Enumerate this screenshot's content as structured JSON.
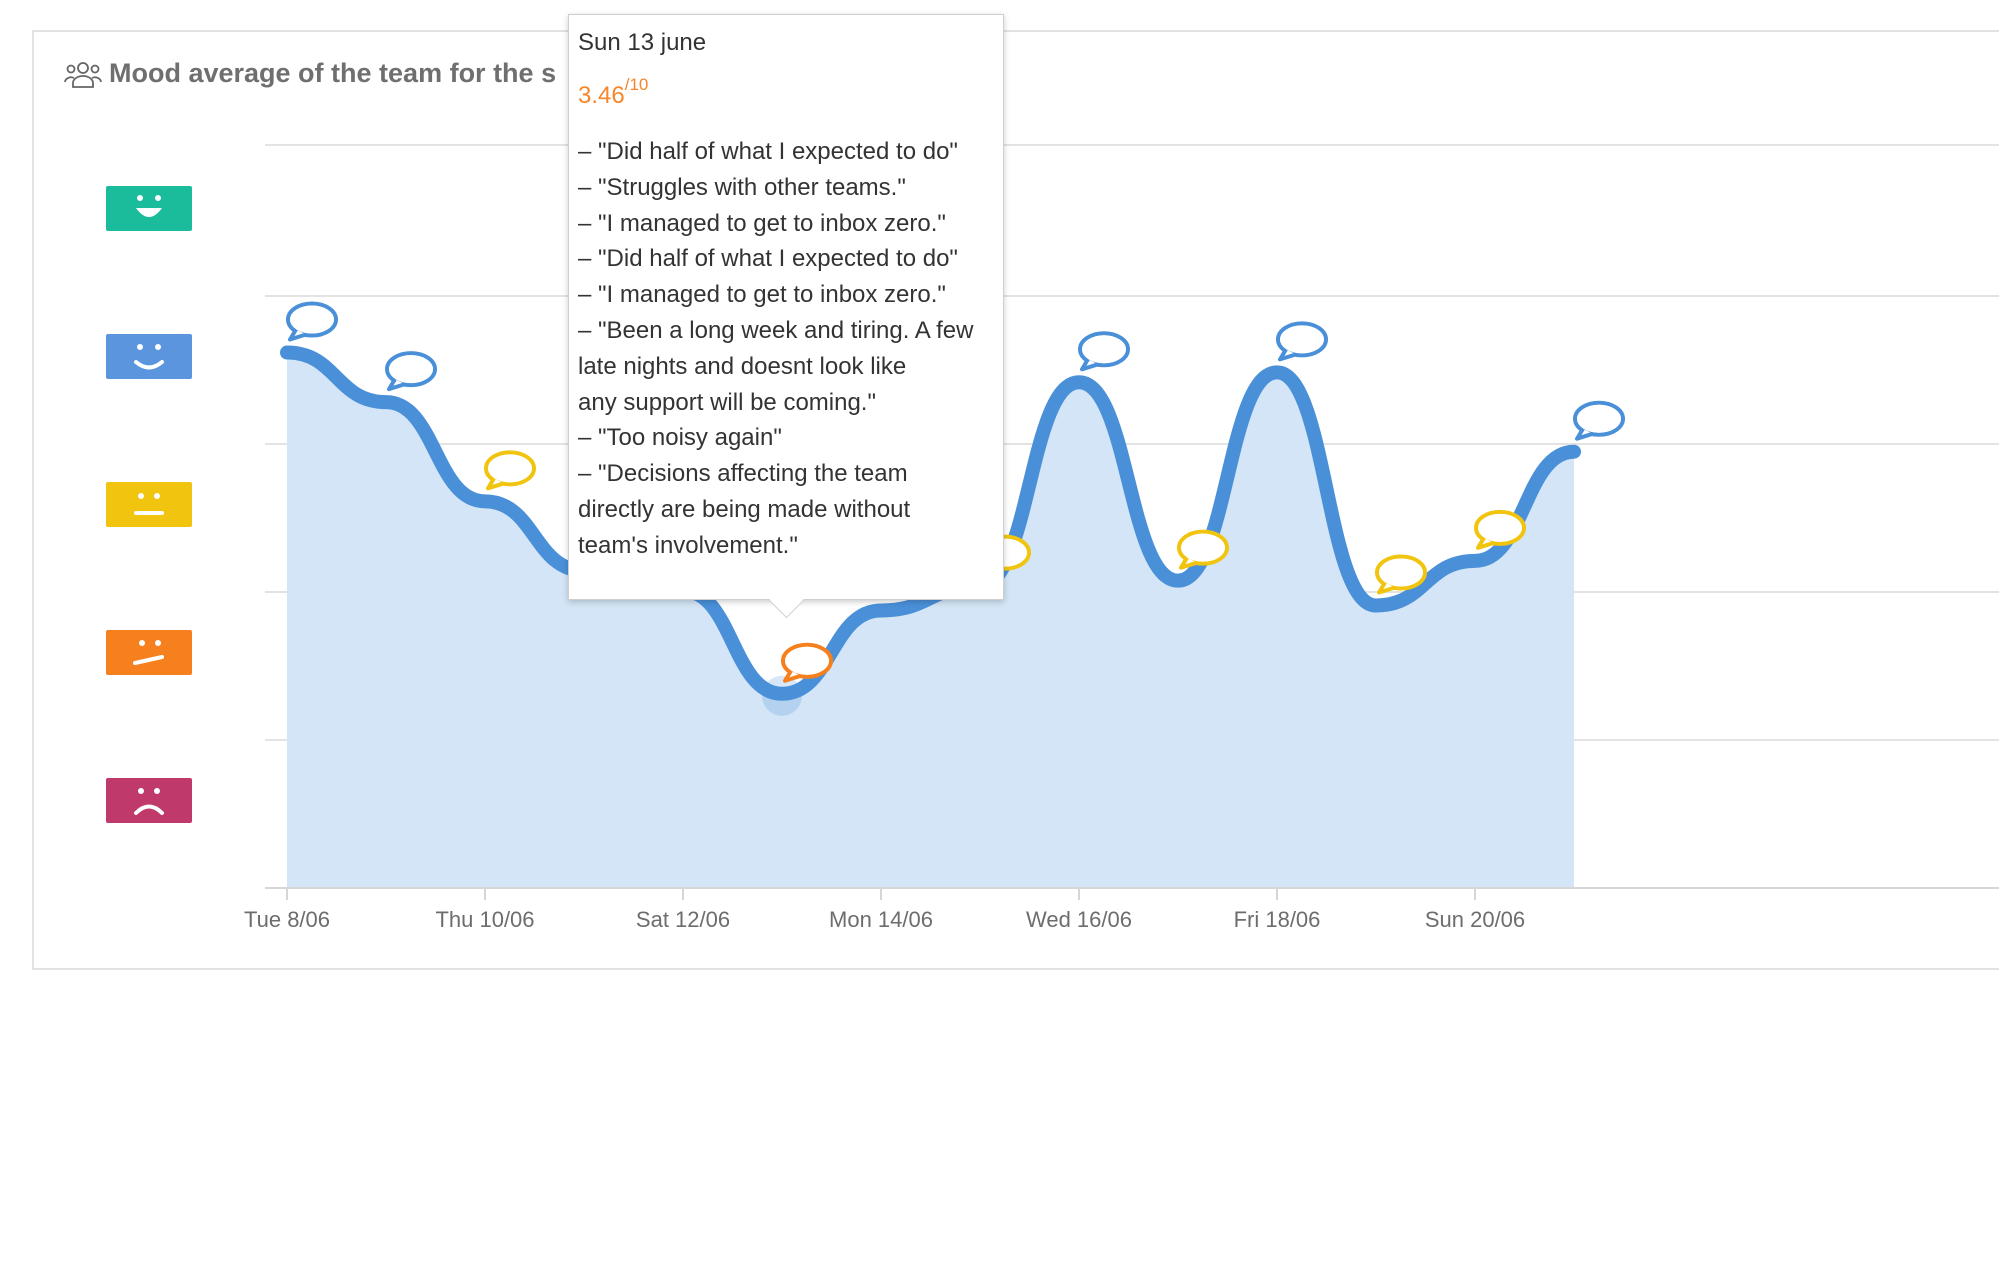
{
  "card": {
    "title": "Mood average of the team for the s"
  },
  "icons": {
    "team": "team-people-icon",
    "comment": "speech-bubble-icon"
  },
  "mood_levels": [
    {
      "name": "very-happy",
      "color": "#1abc9c",
      "icon": "very-happy-face-icon"
    },
    {
      "name": "happy",
      "color": "#5b95de",
      "icon": "happy-face-icon"
    },
    {
      "name": "neutral",
      "color": "#f1c40f",
      "icon": "neutral-face-icon"
    },
    {
      "name": "unhappy",
      "color": "#f7801e",
      "icon": "unhappy-face-icon"
    },
    {
      "name": "very-unhappy",
      "color": "#c0396b",
      "icon": "very-unhappy-face-icon"
    }
  ],
  "colors": {
    "line": "#4a90d9",
    "area": "#d3e5f6",
    "grid": "#e3e3e3",
    "tick_label": "#6d6d6d"
  },
  "chart_data": {
    "type": "area",
    "x_tick_labels": [
      "Tue 8/06",
      "Thu 10/06",
      "Sat 12/06",
      "Mon 14/06",
      "Wed 16/06",
      "Fri 18/06",
      "Sun 20/06"
    ],
    "x": [
      "8/06",
      "9/06",
      "10/06",
      "11/06",
      "12/06",
      "13/06",
      "14/06",
      "15/06",
      "16/06",
      "17/06",
      "18/06",
      "19/06",
      "20/06",
      "21/06"
    ],
    "values": [
      6.9,
      6.4,
      5.4,
      4.7,
      4.5,
      3.46,
      4.3,
      4.55,
      6.6,
      4.6,
      6.7,
      4.35,
      4.8,
      5.9
    ],
    "comment_colors": [
      "#4a90d9",
      "#4a90d9",
      "#f1c40f",
      "#f1c40f",
      "#f1c40f",
      "#f7801e",
      "#f1c40f",
      "#f1c40f",
      "#4a90d9",
      "#f1c40f",
      "#4a90d9",
      "#f1c40f",
      "#f1c40f",
      "#4a90d9"
    ],
    "ylim": [
      0,
      10
    ],
    "grid": true
  },
  "tooltip": {
    "date": "Sun 13 june",
    "score": "3.46",
    "score_max": "/10",
    "comments": [
      "– \"Did half of what I expected to do\"",
      "– \"Struggles with other teams.\"",
      "– \"I managed to get to inbox zero.\"",
      "– \"Did half of what I expected to do\"",
      "– \"I managed to get to inbox zero.\"",
      "– \"Been a long week and tiring. A few\nlate nights and doesnt look like\nany support will be coming.\"",
      "– \"Too noisy again\"",
      "– \"Decisions affecting the team\ndirectly are being made without\nteam's involvement.\""
    ]
  }
}
